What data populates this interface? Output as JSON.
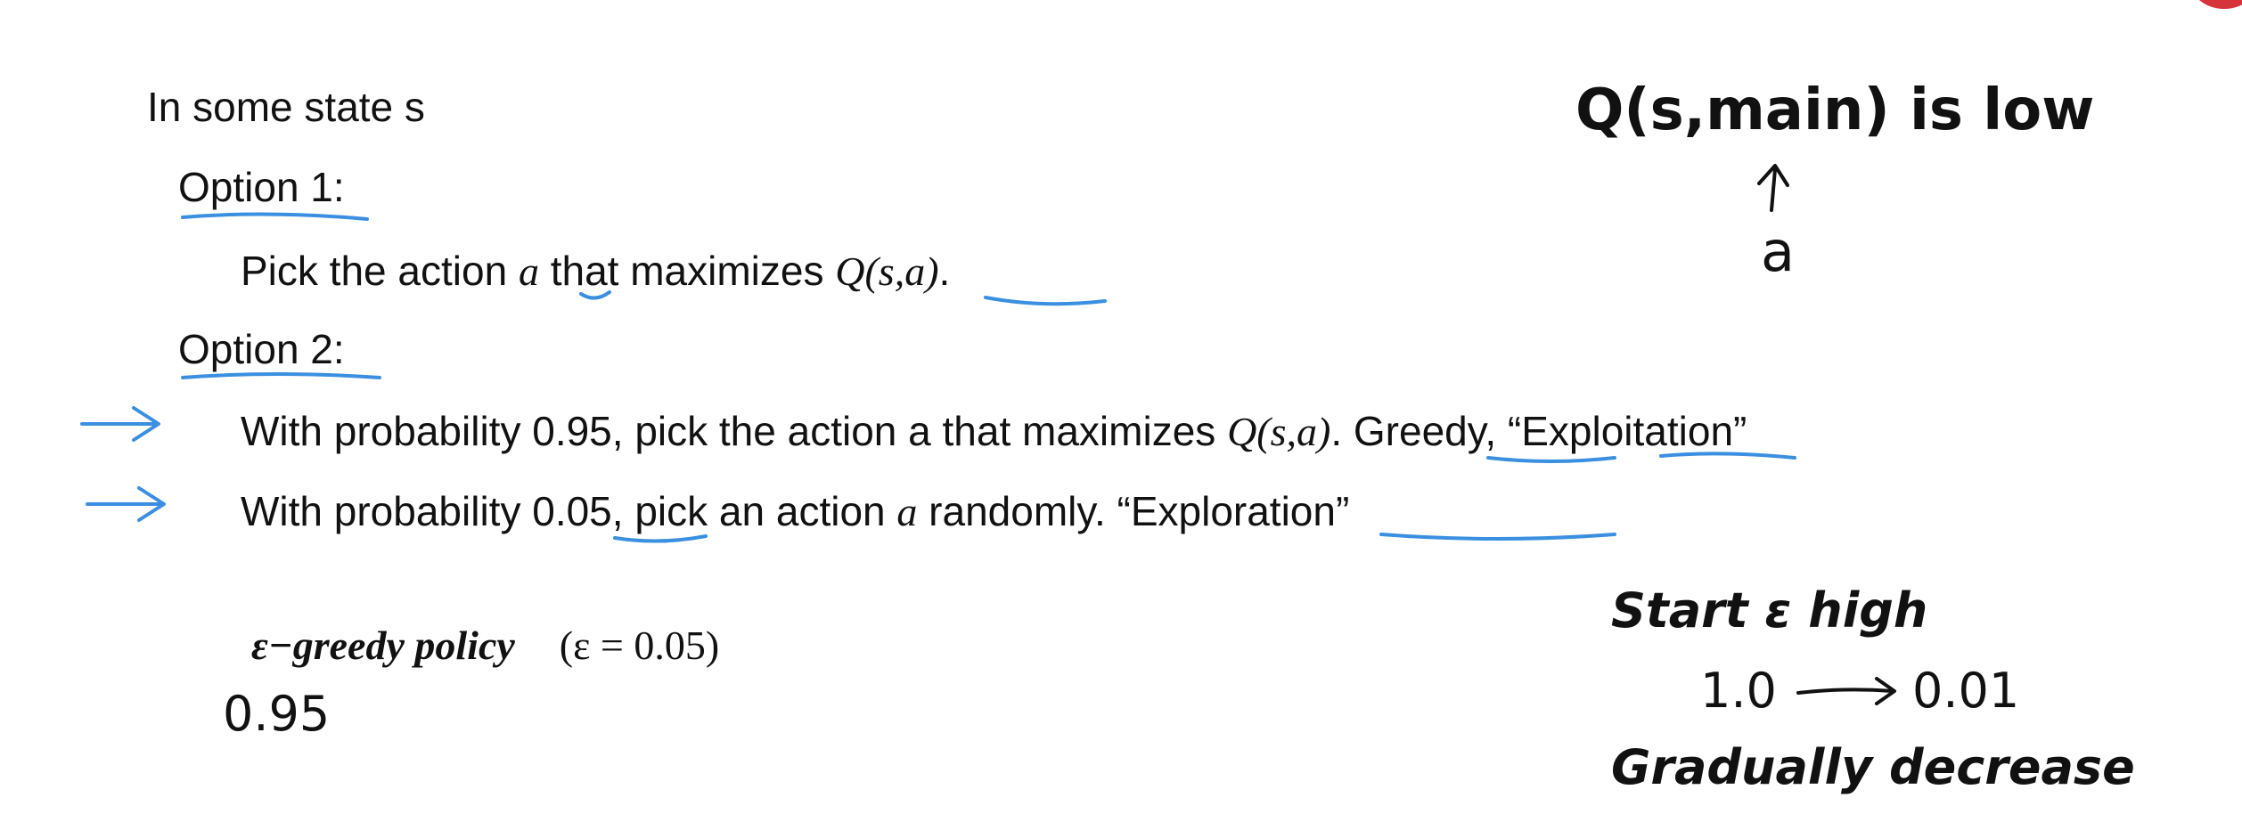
{
  "slide": {
    "heading": "In some state s",
    "option1_label": "Option 1",
    "option1_text_a": "Pick the action ",
    "option1_var": "a",
    "option1_text_b": " that maximizes ",
    "option1_q": "Q(s,a)",
    "option1_end": ".",
    "option2_label": "Option 2",
    "colon": ":",
    "line1_a": "With probability 0.95, pick the action a that maximizes ",
    "line1_q": "Q(s,a)",
    "line1_b": ". ",
    "line1_greedy": "Greedy",
    "line1_c": ", “Exploitation”",
    "line2_a": "With probability ",
    "line2_prob": "0.05",
    "line2_b": ", pick an action ",
    "line2_var": "a",
    "line2_c": " randomly. ",
    "line2_exploration": "“Exploration”",
    "policy_name": "ε−greedy policy",
    "policy_param": "(ε = 0.05)"
  },
  "annotations": {
    "q_note": "Q(s,main) is low",
    "a_note": "a",
    "prob_note": "0.95",
    "start_note": "Start ε high",
    "range_start": "1.0",
    "range_end": "0.01",
    "decrease_note": "Gradually decrease"
  },
  "colors": {
    "highlight": "#3b8fe0",
    "ink": "#111111",
    "corner_mark": "#d6333a"
  }
}
